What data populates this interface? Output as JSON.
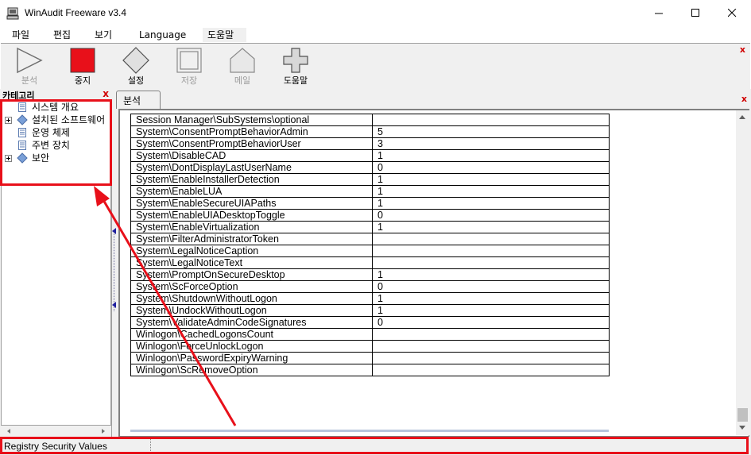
{
  "window": {
    "title": "WinAudit Freeware v3.4"
  },
  "menu": [
    {
      "label": "파일"
    },
    {
      "label": "편집"
    },
    {
      "label": "보기"
    },
    {
      "label": "Language"
    },
    {
      "label": "도움말"
    }
  ],
  "toolbar": [
    {
      "label": "분석",
      "icon": "play-icon",
      "enabled": false
    },
    {
      "label": "중지",
      "icon": "stop-icon",
      "enabled": true
    },
    {
      "label": "설정",
      "icon": "diamond-icon",
      "enabled": true
    },
    {
      "label": "저장",
      "icon": "save-icon",
      "enabled": false
    },
    {
      "label": "메일",
      "icon": "mail-icon",
      "enabled": false
    },
    {
      "label": "도움말",
      "icon": "help-cross-icon",
      "enabled": true
    }
  ],
  "category_panel": {
    "title": "카테고리",
    "items": [
      {
        "label": "시스템 개요",
        "icon": "document-icon",
        "expandable": false
      },
      {
        "label": "설치된 소프트웨어",
        "icon": "diamond-icon",
        "expandable": true
      },
      {
        "label": "운영 체제",
        "icon": "document-icon",
        "expandable": false
      },
      {
        "label": "주변 장치",
        "icon": "document-icon",
        "expandable": false
      },
      {
        "label": "보안",
        "icon": "diamond-icon",
        "expandable": true
      }
    ]
  },
  "tab": {
    "label": "분석"
  },
  "registry_rows": [
    [
      "Session Manager\\SubSystems\\optional",
      ""
    ],
    [
      "System\\ConsentPromptBehaviorAdmin",
      "5"
    ],
    [
      "System\\ConsentPromptBehaviorUser",
      "3"
    ],
    [
      "System\\DisableCAD",
      "1"
    ],
    [
      "System\\DontDisplayLastUserName",
      "0"
    ],
    [
      "System\\EnableInstallerDetection",
      "1"
    ],
    [
      "System\\EnableLUA",
      "1"
    ],
    [
      "System\\EnableSecureUIAPaths",
      "1"
    ],
    [
      "System\\EnableUIADesktopToggle",
      "0"
    ],
    [
      "System\\EnableVirtualization",
      "1"
    ],
    [
      "System\\FilterAdministratorToken",
      ""
    ],
    [
      "System\\LegalNoticeCaption",
      ""
    ],
    [
      "System\\LegalNoticeText",
      ""
    ],
    [
      "System\\PromptOnSecureDesktop",
      "1"
    ],
    [
      "System\\ScForceOption",
      "0"
    ],
    [
      "System\\ShutdownWithoutLogon",
      "1"
    ],
    [
      "System\\UndockWithoutLogon",
      "1"
    ],
    [
      "System\\ValidateAdminCodeSignatures",
      "0"
    ],
    [
      "Winlogon\\CachedLogonsCount",
      ""
    ],
    [
      "Winlogon\\ForceUnlockLogon",
      ""
    ],
    [
      "Winlogon\\PasswordExpiryWarning",
      ""
    ],
    [
      "Winlogon\\ScRemoveOption",
      ""
    ]
  ],
  "status": {
    "text": "Registry Security Values"
  },
  "colors": {
    "annotation": "#e8101a",
    "stop": "#e8101a"
  }
}
